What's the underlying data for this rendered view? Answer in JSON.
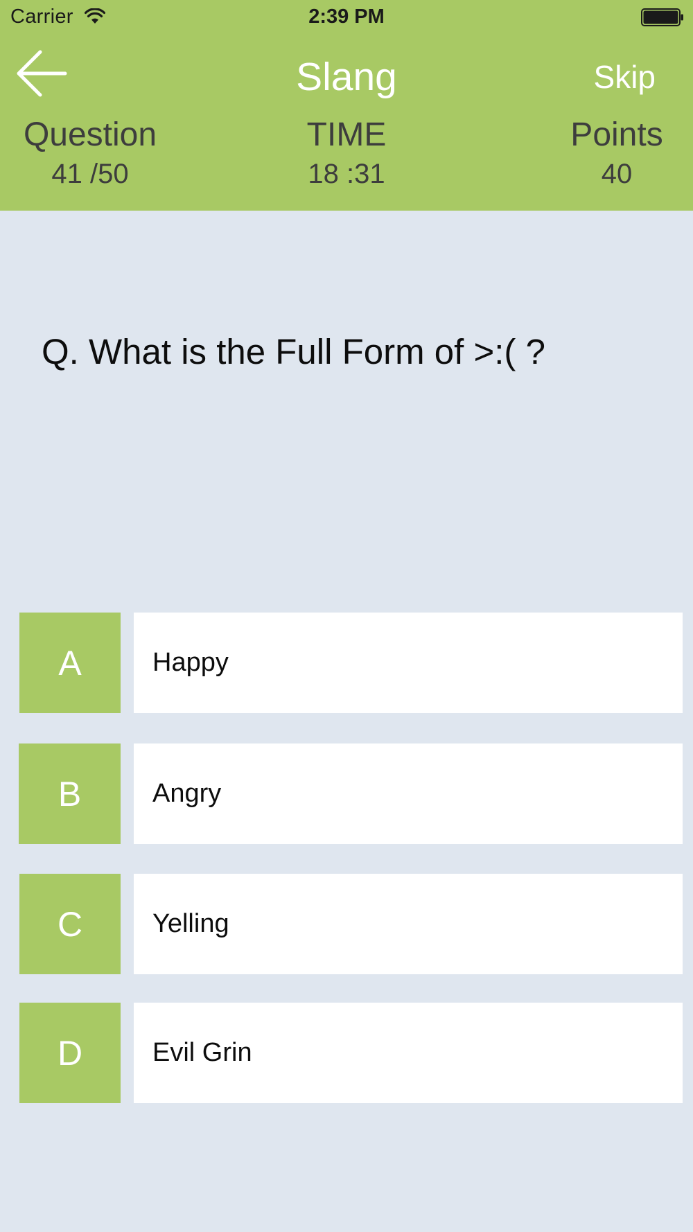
{
  "status_bar": {
    "carrier": "Carrier",
    "time": "2:39 PM",
    "wifi_icon": "wifi-icon",
    "battery_icon": "battery-icon"
  },
  "nav": {
    "back_icon": "arrow-left-icon",
    "title": "Slang",
    "skip_label": "Skip"
  },
  "stats": {
    "question_label": "Question",
    "question_value": "41 /50",
    "time_label": "TIME",
    "time_value": "18 :31",
    "points_label": "Points",
    "points_value": "40"
  },
  "question": {
    "text": "Q. What is the Full Form of >:(   ?"
  },
  "options": [
    {
      "letter": "A",
      "text": "Happy"
    },
    {
      "letter": "B",
      "text": "Angry"
    },
    {
      "letter": "C",
      "text": "Yelling"
    },
    {
      "letter": "D",
      "text": "Evil Grin"
    }
  ],
  "colors": {
    "accent": "#a8c964",
    "background": "#dfe6ef",
    "answer_bg": "#ffffff"
  }
}
